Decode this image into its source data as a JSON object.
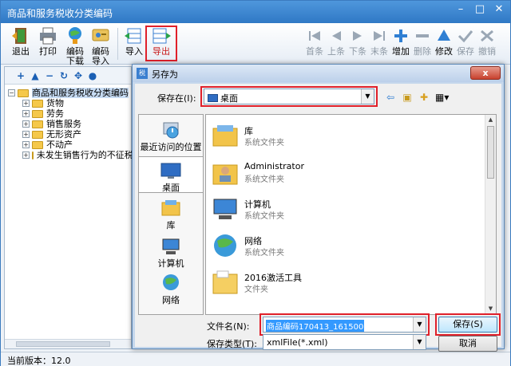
{
  "app": {
    "title": "商品和服务税收分类编码"
  },
  "toolbar": {
    "exit": "退出",
    "print": "打印",
    "code_download": "编码下载",
    "code_import": "编码导入",
    "import": "导入",
    "export": "导出",
    "first": "首条",
    "prev": "上条",
    "next": "下条",
    "last": "末条",
    "add": "增加",
    "delete": "删除",
    "edit": "修改",
    "save": "保存",
    "cancel": "撤销"
  },
  "tree": {
    "root": "商品和服务税收分类编码",
    "children": [
      "货物",
      "劳务",
      "销售服务",
      "无形资产",
      "不动产",
      "未发生销售行为的不征税"
    ]
  },
  "status": {
    "text": "当前版本：12.0"
  },
  "dialog": {
    "title": "另存为",
    "close": "x",
    "save_in_label": "保存在(I):",
    "save_in_value": "桌面",
    "places": [
      "最近访问的位置",
      "桌面",
      "库",
      "计算机",
      "网络"
    ],
    "files": [
      {
        "name": "库",
        "type": "系统文件夹"
      },
      {
        "name": "Administrator",
        "type": "系统文件夹"
      },
      {
        "name": "计算机",
        "type": "系统文件夹"
      },
      {
        "name": "网络",
        "type": "系统文件夹"
      },
      {
        "name": "2016激活工具",
        "type": "文件夹"
      }
    ],
    "filename_label": "文件名(N):",
    "filename_value": "商品编码170413_161500",
    "filetype_label": "保存类型(T):",
    "filetype_value": "xmlFile(*.xml)",
    "save_button": "保存(S)",
    "cancel_button": "取消"
  },
  "colors": {
    "titlebar": "#2f78c5",
    "highlight": "#e0202a",
    "selection": "#3399ff"
  }
}
